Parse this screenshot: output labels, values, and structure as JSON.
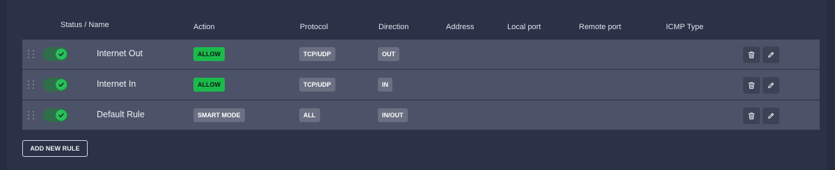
{
  "header": {
    "status_name": "Status / Name",
    "action": "Action",
    "protocol": "Protocol",
    "direction": "Direction",
    "address": "Address",
    "local_port": "Local port",
    "remote_port": "Remote port",
    "icmp_type": "ICMP Type"
  },
  "rules": [
    {
      "enabled": true,
      "name": "Internet Out",
      "action": "ALLOW",
      "protocol": "TCP/UDP",
      "direction": "OUT",
      "address": "",
      "local_port": "",
      "remote_port": "",
      "icmp_type": ""
    },
    {
      "enabled": true,
      "name": "Internet In",
      "action": "ALLOW",
      "protocol": "TCP/UDP",
      "direction": "IN",
      "address": "",
      "local_port": "",
      "remote_port": "",
      "icmp_type": ""
    },
    {
      "enabled": true,
      "name": "Default Rule",
      "action": "SMART MODE",
      "protocol": "ALL",
      "direction": "IN/OUT",
      "address": "",
      "local_port": "",
      "remote_port": "",
      "icmp_type": ""
    }
  ],
  "row_icons": {
    "drag": "drag-handle-icon",
    "toggle_check": "check-icon",
    "delete": "trash-icon",
    "edit": "pencil-icon"
  },
  "add_button": {
    "label": "ADD NEW RULE"
  },
  "colors": {
    "background": "#2b3247",
    "row_background": "#4c5368",
    "allow_badge": "#1bbb4b",
    "neutral_badge": "#6a7082",
    "toggle_on": "#27c05b"
  }
}
